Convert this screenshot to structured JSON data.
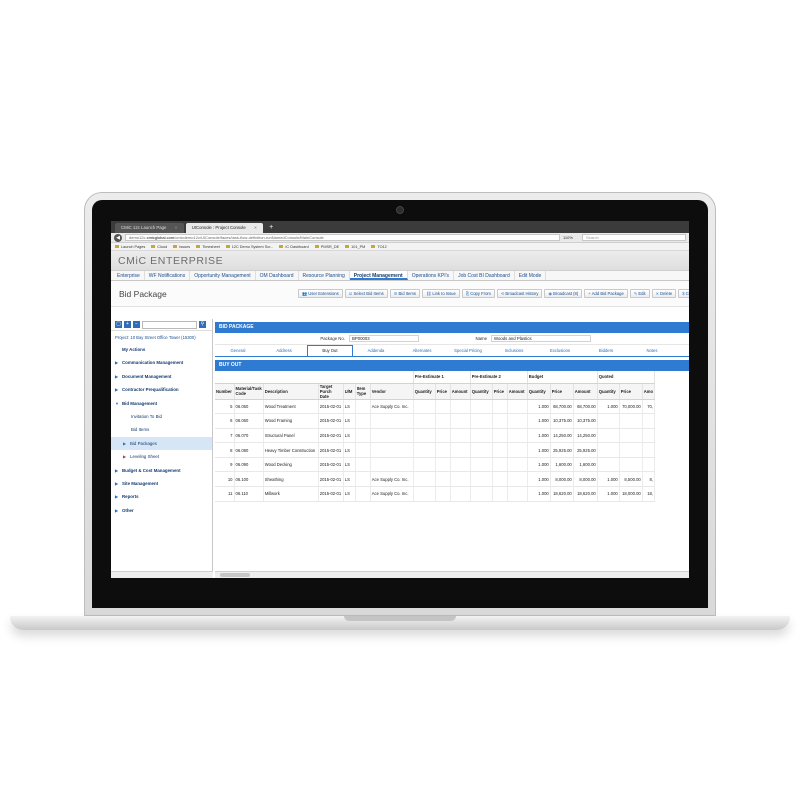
{
  "browser": {
    "tabs": [
      {
        "label": "CMiC 12c Launch Page"
      },
      {
        "label": "UIConsole : Project Console"
      }
    ],
    "new_tab": "+",
    "url_prefix": "demo12c.",
    "url_domain": "cmicglobal.com",
    "url_path": "/cmicdemo12c/UIConsole/faces/task-flow-definition-runNamedConsole/MainConsole",
    "zoom": "110%",
    "search_placeholder": "Search",
    "bookmarks": [
      "Launch Pages",
      "Cloud",
      "Issues",
      "Timesheet",
      "12C Demo System Scr...",
      "IC Dashboard",
      "PMSR_DE",
      "101_PM",
      "TO12"
    ]
  },
  "app": {
    "brand": "CMiC ENTERPRISE",
    "menu": [
      "Enterprise",
      "WF Notifications",
      "Opportunity Management",
      "OM Dashboard",
      "Resource Planning",
      "Project Management",
      "Operations KPI's",
      "Job Cost BI Dashboard",
      "Edit Mode"
    ],
    "active_menu_index": 5
  },
  "page": {
    "title": "Bid Package",
    "toolbar": [
      {
        "icon": "users-icon",
        "label": "User Extensions"
      },
      {
        "icon": "select-icon",
        "label": "Select Bid Items"
      },
      {
        "icon": "list-icon",
        "label": "Bid Items"
      },
      {
        "icon": "link-icon",
        "label": "Link to Issue"
      },
      {
        "icon": "copy-icon",
        "label": "Copy From"
      },
      {
        "icon": "history-icon",
        "label": "Broadcast History"
      },
      {
        "icon": "broadcast-icon",
        "label": "Broadcast (8)"
      },
      {
        "icon": "add-icon",
        "label": "Add Bid Package"
      },
      {
        "icon": "edit-icon",
        "label": "Edit"
      },
      {
        "icon": "delete-icon",
        "label": "Delete"
      },
      {
        "icon": "dollar-icon",
        "label": "Cl"
      }
    ]
  },
  "sidebar": {
    "project": "Project: 10 Bay Street Office Tower (15300)",
    "items": [
      {
        "label": "My Actions",
        "type": "grp-plain"
      },
      {
        "label": "Communication Management",
        "type": "grp"
      },
      {
        "label": "Document Management",
        "type": "grp"
      },
      {
        "label": "Contractor Prequalification",
        "type": "grp"
      },
      {
        "label": "Bid Management",
        "type": "grp-open"
      },
      {
        "label": "Invitation To Bid",
        "type": "sub"
      },
      {
        "label": "Bid Items",
        "type": "sub"
      },
      {
        "label": "Bid Packages",
        "type": "sub2-selected"
      },
      {
        "label": "Leveling Sheet",
        "type": "sub2"
      },
      {
        "label": "Budget & Cost Management",
        "type": "grp"
      },
      {
        "label": "Site Management",
        "type": "grp"
      },
      {
        "label": "Reports",
        "type": "grp"
      },
      {
        "label": "Other",
        "type": "grp"
      }
    ]
  },
  "bid_package": {
    "header": "BID PACKAGE",
    "package_no_label": "Package No.",
    "package_no": "BP00003",
    "name_label": "Name",
    "name": "Woods and Plastics",
    "tabs": [
      "General",
      "Address",
      "Buy Out",
      "Addenda",
      "Alternates",
      "Special Pricing",
      "Inclusions",
      "Exclusions",
      "Bidders",
      "Notes"
    ],
    "active_tab_index": 2
  },
  "buyout": {
    "header": "BUY OUT",
    "group_headers": {
      "pre1": "Pre-Estimate 1",
      "pre2": "Pre-Estimate 2",
      "budget": "Budget",
      "quoted": "Quoted"
    },
    "columns": [
      "Number",
      "Material/Task Code",
      "Description",
      "Target Purch Date",
      "U/M",
      "Item Type",
      "Vendor",
      "Quantity",
      "Price",
      "Amount",
      "Quantity",
      "Price",
      "Amount",
      "Quantity",
      "Price",
      "Amount",
      "Quantity",
      "Price",
      "Amo"
    ],
    "rows": [
      [
        "5",
        "06.050",
        "Wood Treatment",
        "2015-02-01",
        "LS",
        "",
        "Ace Supply Co. Inc.",
        "",
        "",
        "",
        "",
        "",
        "",
        "1.000",
        "68,700.00",
        "68,700.00",
        "1.000",
        "70,000.00",
        "70,"
      ],
      [
        "6",
        "06.060",
        "Wood Framing",
        "2015-02-01",
        "LS",
        "",
        "",
        "",
        "",
        "",
        "",
        "",
        "",
        "1.000",
        "10,375.00",
        "10,375.00",
        "",
        "",
        ""
      ],
      [
        "7",
        "06.070",
        "Structural Panel",
        "2015-02-01",
        "LS",
        "",
        "",
        "",
        "",
        "",
        "",
        "",
        "",
        "1.000",
        "14,250.00",
        "14,250.00",
        "",
        "",
        ""
      ],
      [
        "8",
        "06.080",
        "Heavy Timber Construction",
        "2015-02-01",
        "LS",
        "",
        "",
        "",
        "",
        "",
        "",
        "",
        "",
        "1.000",
        "25,925.00",
        "25,925.00",
        "",
        "",
        ""
      ],
      [
        "9",
        "06.090",
        "Wood Decking",
        "2015-02-01",
        "LS",
        "",
        "",
        "",
        "",
        "",
        "",
        "",
        "",
        "1.000",
        "1,600.00",
        "1,600.00",
        "",
        "",
        ""
      ],
      [
        "10",
        "06.100",
        "Sheathing",
        "2015-02-01",
        "LS",
        "",
        "Ace Supply Co. Inc.",
        "",
        "",
        "",
        "",
        "",
        "",
        "1.000",
        "8,000.00",
        "8,000.00",
        "1.000",
        "8,500.00",
        "8,"
      ],
      [
        "11",
        "06.110",
        "Millwork",
        "2015-02-01",
        "LS",
        "",
        "Ace Supply Co. Inc.",
        "",
        "",
        "",
        "",
        "",
        "",
        "1.000",
        "18,620.00",
        "18,620.00",
        "1.000",
        "18,000.00",
        "18,"
      ]
    ]
  }
}
